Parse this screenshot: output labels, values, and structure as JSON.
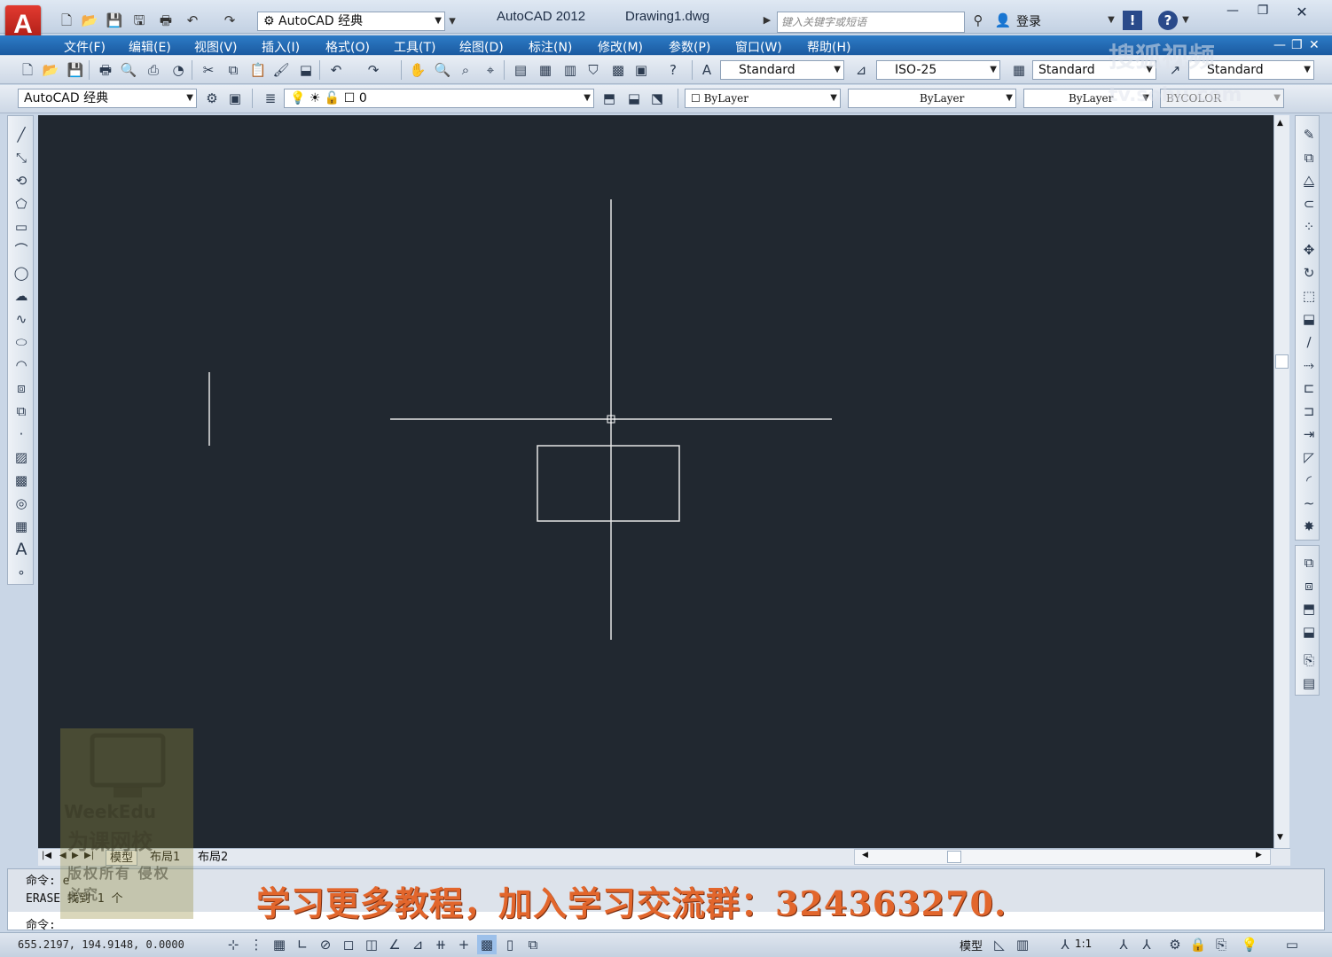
{
  "app": {
    "logo_letter": "A",
    "title": "AutoCAD 2012",
    "filename": "Drawing1.dwg",
    "workspace": "AutoCAD 经典",
    "search_placeholder": "键入关键字或短语",
    "login": "登录"
  },
  "menu": [
    "文件(F)",
    "编辑(E)",
    "视图(V)",
    "插入(I)",
    "格式(O)",
    "工具(T)",
    "绘图(D)",
    "标注(N)",
    "修改(M)",
    "参数(P)",
    "窗口(W)",
    "帮助(H)"
  ],
  "styles": {
    "text_style": "Standard",
    "dim_style": "ISO-25",
    "table_style": "Standard",
    "mleader_style": "Standard"
  },
  "layers": {
    "workspace_combo": "AutoCAD 经典",
    "current_layer": "0",
    "color": "ByLayer",
    "linetype": "ByLayer",
    "lineweight": "ByLayer",
    "plot_style": "BYCOLOR"
  },
  "tabs": [
    "模型",
    "布局1",
    "布局2"
  ],
  "command": {
    "line1": "命令:  e",
    "line2": "ERASE  找到 1 个",
    "prompt": "命令:",
    "promo": "学习更多教程，加入学习交流群：324363270."
  },
  "status": {
    "coords": "655.2197,  194.9148,  0.0000",
    "model_label": "模型",
    "scale": "1:1"
  },
  "watermark": {
    "brand": "WeekEdu",
    "brand_cn": "为课网校",
    "overlay_top": "搜狐视频",
    "overlay_bottom": "tv.sohu.com",
    "stamp": "版权所有  侵权必究"
  },
  "colors": {
    "canvas_bg": "#212830",
    "menubar": "#1b5aa0",
    "promo_text": "#e2662c",
    "line": "#e6e6e6"
  },
  "icons": {
    "left_toolbar": [
      "line-icon",
      "construction-line-icon",
      "polyline-icon",
      "polygon-icon",
      "rectangle-icon",
      "arc-icon",
      "circle-icon",
      "revision-cloud-icon",
      "spline-icon",
      "ellipse-icon",
      "ellipse-arc-icon",
      "insert-block-icon",
      "make-block-icon",
      "point-icon",
      "hatch-icon",
      "gradient-icon",
      "region-icon",
      "table-icon",
      "mtext-icon",
      "add-selected-icon"
    ],
    "right_toolbar": [
      "erase-icon",
      "copy-icon",
      "mirror-icon",
      "offset-icon",
      "array-icon",
      "move-icon",
      "rotate-icon",
      "scale-icon",
      "stretch-icon",
      "trim-icon",
      "extend-icon",
      "break-at-point-icon",
      "break-icon",
      "join-icon",
      "chamfer-icon",
      "fillet-icon",
      "blend-icon",
      "explode-icon"
    ]
  }
}
